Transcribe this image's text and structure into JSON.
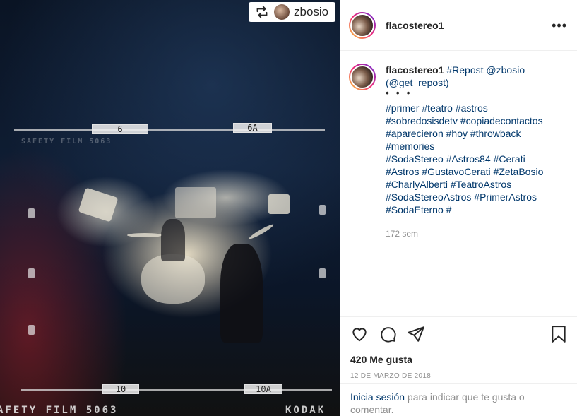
{
  "repost_chip": {
    "username": "zbosio",
    "icon": "repost-icon"
  },
  "film": {
    "top_labels": [
      "6",
      "6A"
    ],
    "bottom_labels": [
      "10",
      "10A"
    ],
    "edge_text_left": "AFETY FILM 5063",
    "edge_text_top": "SAFETY FILM 5063",
    "edge_text_right": "KODAK"
  },
  "header": {
    "username": "flacostereo1",
    "more_icon": "more-options-icon",
    "more_label": "•••"
  },
  "caption": {
    "username": "flacostereo1",
    "mentions": [
      "#Repost",
      "@zbosio",
      "(@get_repost)"
    ],
    "dots": "• • •",
    "hashtag_lines": [
      [
        "#primer",
        "#teatro",
        "#astros"
      ],
      [
        "#sobredosisdetv",
        "#copiadecontactos"
      ],
      [
        "#aparecieron",
        "#hoy",
        "#throwback"
      ],
      [
        "#memories"
      ],
      [
        "#SodaStereo",
        "#Astros84",
        "#Cerati"
      ],
      [
        "#Astros",
        "#GustavoCerati",
        "#ZetaBosio"
      ],
      [
        "#CharlyAlberti",
        "#TeatroAstros"
      ],
      [
        "#SodaStereoAstros",
        "#PrimerAstros"
      ],
      [
        "#SodaEterno",
        "#"
      ]
    ],
    "time_ago": "172 sem"
  },
  "actions": {
    "icons": [
      "heart-icon",
      "comment-icon",
      "share-icon",
      "bookmark-icon"
    ],
    "likes": "420 Me gusta",
    "date": "12 de marzo de 2018"
  },
  "login": {
    "link": "Inicia sesión",
    "text": " para indicar que te gusta o comentar."
  },
  "colors": {
    "link": "#00376b",
    "muted": "#8e8e8e",
    "text": "#262626",
    "border": "#efefef"
  }
}
